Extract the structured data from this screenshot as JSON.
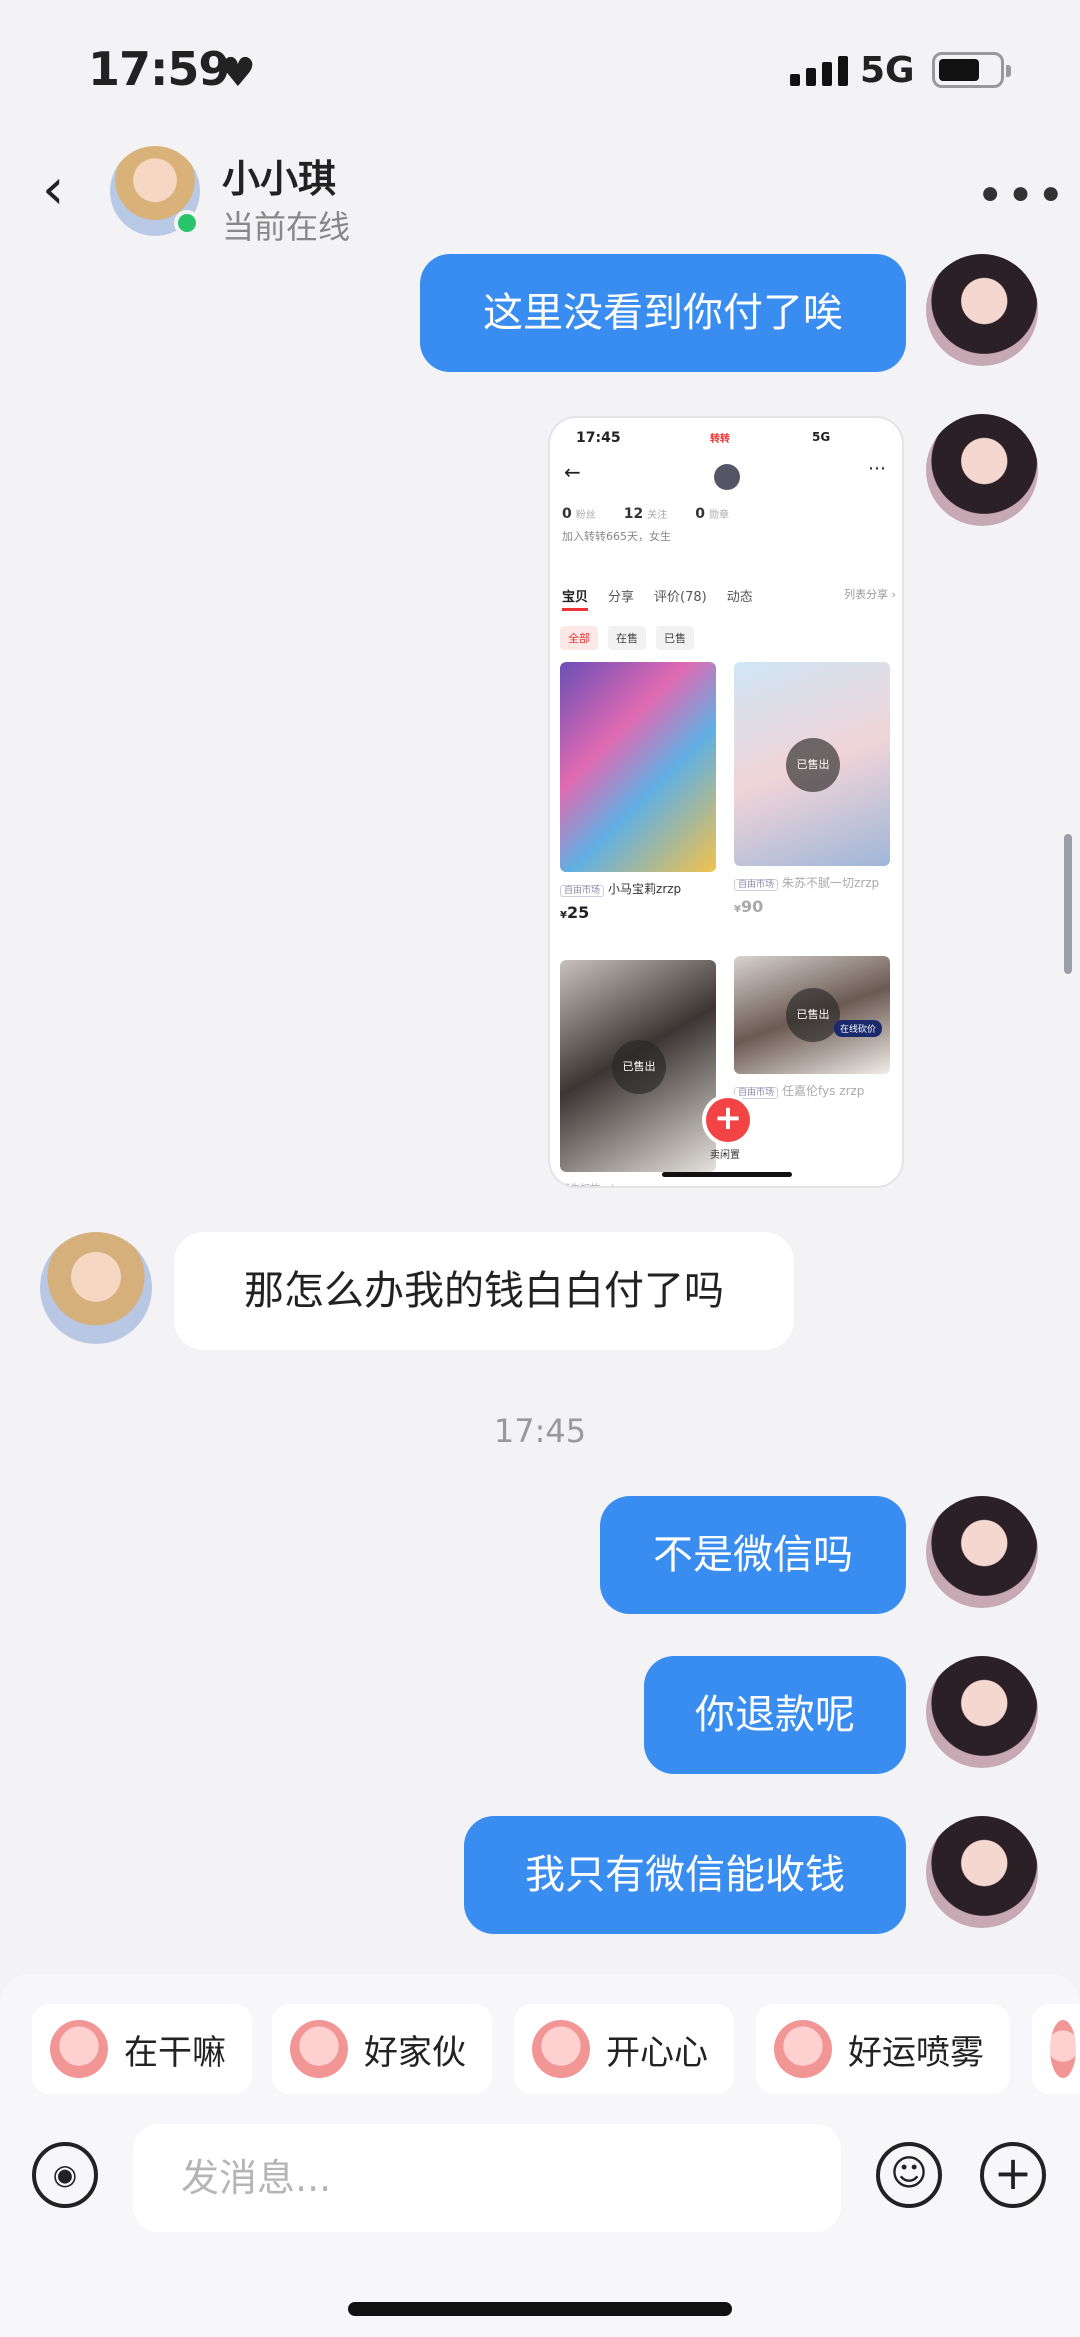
{
  "status_bar": {
    "time": "17:59",
    "network": "5G"
  },
  "header": {
    "peer_name": "小小琪",
    "peer_status": "当前在线",
    "more": "•••"
  },
  "messages": [
    {
      "from": "me",
      "text": "这里没看到你付了唉"
    },
    {
      "from": "me",
      "type": "image"
    },
    {
      "from": "peer",
      "text": "那怎么办我的钱白白付了吗"
    },
    {
      "from": "me",
      "text": "不是微信吗"
    },
    {
      "from": "me",
      "text": "你退款呢"
    },
    {
      "from": "me",
      "text": "我只有微信能收钱"
    }
  ],
  "timestamp": "17:45",
  "shared_screenshot": {
    "time": "17:45",
    "app": "转转",
    "network": "5G",
    "stats": [
      {
        "value": "0",
        "label": "粉丝"
      },
      {
        "value": "12",
        "label": "关注"
      },
      {
        "value": "0",
        "label": "勋章"
      }
    ],
    "join_text": "加入转转665天，女生",
    "tabs": [
      "宝贝",
      "分享",
      "评价(78)",
      "动态"
    ],
    "list_share": "列表分享 ›",
    "filters": [
      "全部",
      "在售",
      "已售"
    ],
    "items": [
      {
        "tag": "自由市场",
        "title": "小马宝莉zrzp",
        "price": "25",
        "sold": ""
      },
      {
        "tag": "自由市场",
        "title": "朱苏不腻一切zrzp",
        "price": "90",
        "sold": "已售出"
      },
      {
        "tag": "",
        "title": "",
        "price": "",
        "sold": "已售出"
      },
      {
        "tag": "自由市场",
        "title": "任嘉伦fys zrzp",
        "price": "",
        "sold": "已售出"
      }
    ],
    "negotiate": "在线砍价",
    "sell_label": "卖闲置",
    "bottom_item": "周生如故sxb zrzp"
  },
  "quick_replies": [
    "在干嘛",
    "好家伙",
    "开心心",
    "好运喷雾"
  ],
  "input": {
    "placeholder": "发消息..."
  },
  "colors": {
    "bubble_out": "#3a8df0",
    "bubble_in": "#ffffff",
    "background": "#f3f3f5",
    "online": "#29c46b"
  }
}
